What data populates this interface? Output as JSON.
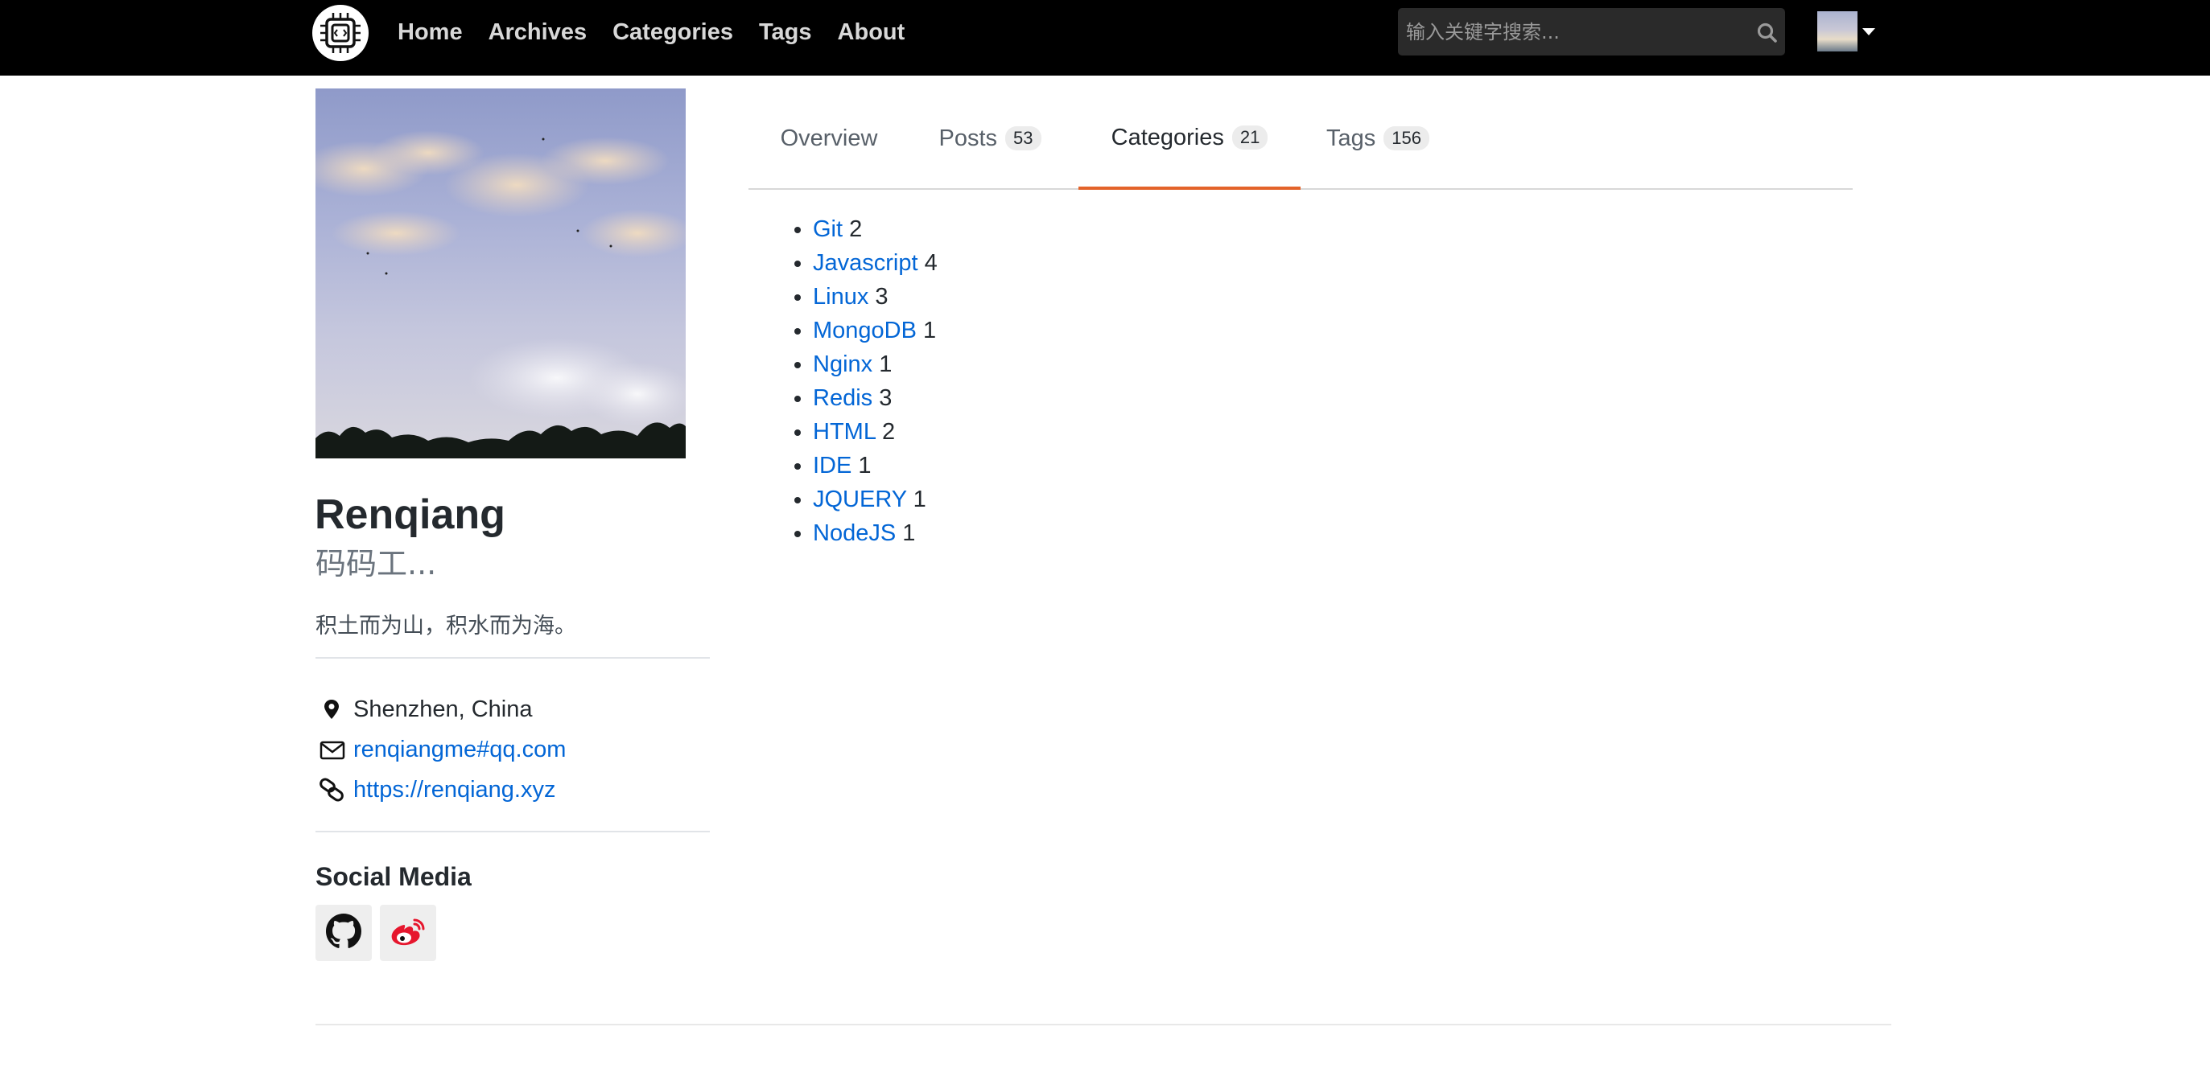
{
  "nav": {
    "links": [
      "Home",
      "Archives",
      "Categories",
      "Tags",
      "About"
    ],
    "search_placeholder": "输入关键字搜索..."
  },
  "profile": {
    "name": "Renqiang",
    "nickname": "码码工...",
    "bio": "积土而为山，积水而为海。",
    "location": "Shenzhen, China",
    "email": "renqiangme#qq.com",
    "website": "https://renqiang.xyz",
    "social_title": "Social Media"
  },
  "tabs": [
    {
      "label": "Overview",
      "count": null
    },
    {
      "label": "Posts",
      "count": "53"
    },
    {
      "label": "Categories",
      "count": "21",
      "active": true
    },
    {
      "label": "Tags",
      "count": "156"
    }
  ],
  "categories": [
    {
      "name": "Git",
      "count": "2"
    },
    {
      "name": "Javascript",
      "count": "4"
    },
    {
      "name": "Linux",
      "count": "3"
    },
    {
      "name": "MongoDB",
      "count": "1"
    },
    {
      "name": "Nginx",
      "count": "1"
    },
    {
      "name": "Redis",
      "count": "3"
    },
    {
      "name": "HTML",
      "count": "2"
    },
    {
      "name": "IDE",
      "count": "1"
    },
    {
      "name": "JQUERY",
      "count": "1"
    },
    {
      "name": "NodeJS",
      "count": "1"
    }
  ],
  "colors": {
    "navbar_bg": "#000000",
    "link": "#0366d6",
    "active_tab_underline": "#e3632a",
    "weibo_red": "#e6162d"
  }
}
